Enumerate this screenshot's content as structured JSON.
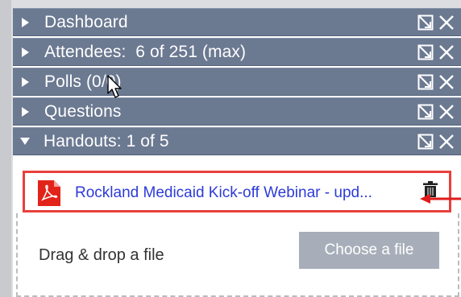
{
  "panels": [
    {
      "label": "Dashboard",
      "expanded": false
    },
    {
      "label": "Attendees:  6 of 251 (max)",
      "expanded": false
    },
    {
      "label": "Polls (0/0)",
      "expanded": false
    },
    {
      "label": "Questions",
      "expanded": false
    },
    {
      "label": "Handouts: 1 of 5",
      "expanded": true
    }
  ],
  "handouts": {
    "file_name": "Rockland Medicaid Kick-off Webinar - upd...",
    "file_icon": "pdf-icon",
    "drop_text": "Drag & drop a file",
    "choose_button": "Choose a file"
  },
  "colors": {
    "bar": "#6b7991",
    "highlight": "#e8403c",
    "link": "#2d3bd8",
    "button": "#a7aeb9"
  }
}
